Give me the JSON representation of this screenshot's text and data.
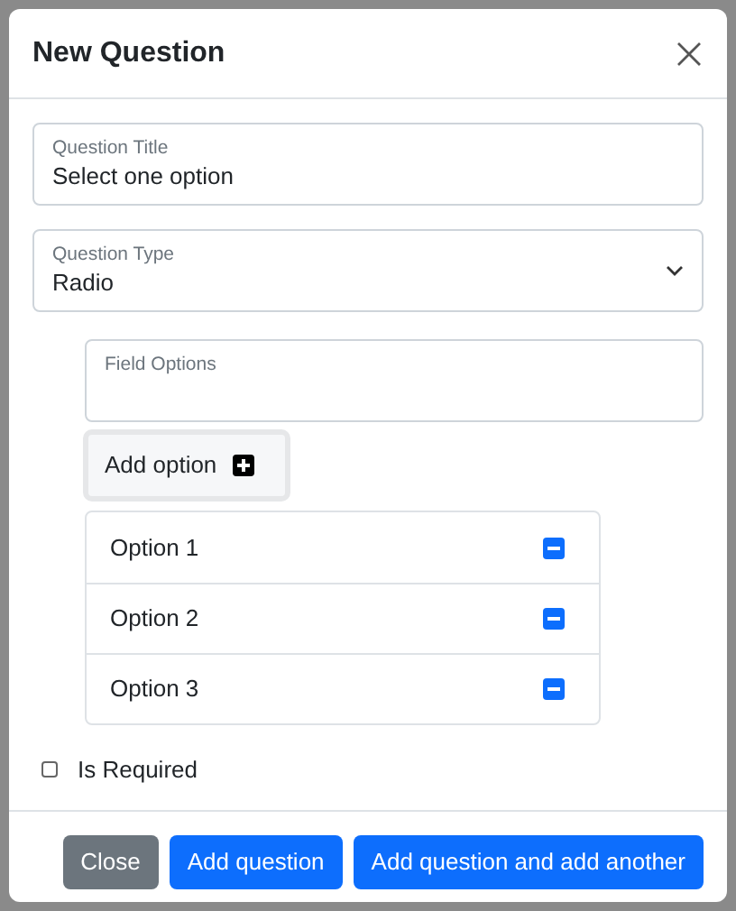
{
  "modal": {
    "title": "New Question",
    "fields": [
      {
        "kind": "input",
        "label": "Question Title",
        "value": "Select one option"
      },
      {
        "kind": "select",
        "label": "Question Type",
        "value": "Radio"
      }
    ],
    "field_options": {
      "placeholder": "Field Options",
      "add_button": "Add option",
      "options": [
        {
          "label": "Option 1"
        },
        {
          "label": "Option 2"
        },
        {
          "label": "Option 3"
        }
      ]
    },
    "required": {
      "label": "Is Required",
      "checked": false
    },
    "buttons": [
      {
        "label": "Close",
        "kind": "secondary"
      },
      {
        "label": "Add question",
        "kind": "primary"
      },
      {
        "label": "Add question and add another",
        "kind": "primary"
      }
    ]
  }
}
